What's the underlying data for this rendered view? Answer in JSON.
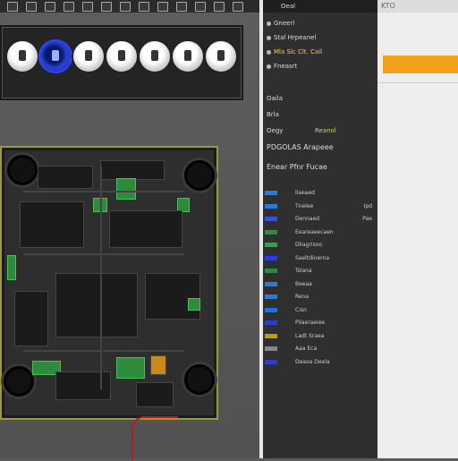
{
  "colors": {
    "accent": "#f2a218",
    "board_outline": "#9a9a3a",
    "wire": "#b81d1d",
    "knob_active": "#2d3fd0"
  },
  "toolbar": {
    "icons": [
      "toolbar-icon",
      "toolbar-icon",
      "toolbar-icon",
      "toolbar-icon",
      "toolbar-icon",
      "toolbar-icon",
      "toolbar-icon",
      "toolbar-icon",
      "toolbar-icon",
      "toolbar-icon",
      "toolbar-icon",
      "toolbar-icon",
      "toolbar-icon"
    ]
  },
  "knobs": {
    "count": 7,
    "active_index": 1
  },
  "panel": {
    "header": "Oeal",
    "items": [
      {
        "label": "Gneerl"
      },
      {
        "label": "Stal Hrpeanel"
      },
      {
        "label": "Mla Slc Clt. Cail"
      },
      {
        "label": "Fneasrt"
      }
    ],
    "section1": "Oaila",
    "section2": "Brla",
    "group_label": "Oegy",
    "group_value": "Reanol",
    "title2": "PDGOLAS Arapeee",
    "title3": "Enear Pfnr Fucae",
    "layers": [
      {
        "color": "#2a7bd8",
        "label": "Ilaeaed",
        "value": ""
      },
      {
        "color": "#2a7bd8",
        "label": "Tnelee",
        "value": "Ipd"
      },
      {
        "color": "#3b4fd8",
        "label": "Dennaed",
        "value": "Pae"
      },
      {
        "color": "#2a8f3a",
        "label": "Eeareaeecaen",
        "value": ""
      },
      {
        "color": "#25a84a",
        "label": "Dliagrisoo",
        "value": ""
      },
      {
        "color": "#2a3fe0",
        "label": "Saeltdinerna",
        "value": ""
      },
      {
        "color": "#2e8b3a",
        "label": "Tslana",
        "value": ""
      },
      {
        "color": "#2a7bd8",
        "label": "Beeaa",
        "value": ""
      },
      {
        "color": "#2a7bd8",
        "label": "Rena",
        "value": ""
      },
      {
        "color": "#2a6bd8",
        "label": "Cisn",
        "value": ""
      },
      {
        "color": "#1f45c8",
        "label": "Pilaeraeiee",
        "value": ""
      },
      {
        "color": "#b0a020",
        "label": "Ladt Sraea",
        "value": ""
      },
      {
        "color": "#888888",
        "label": "Aaa Eca",
        "value": ""
      },
      {
        "color": "#2a3fd0",
        "label": "Deaoa Deela",
        "value": ""
      }
    ]
  },
  "right_pane": {
    "header": "KTO"
  }
}
